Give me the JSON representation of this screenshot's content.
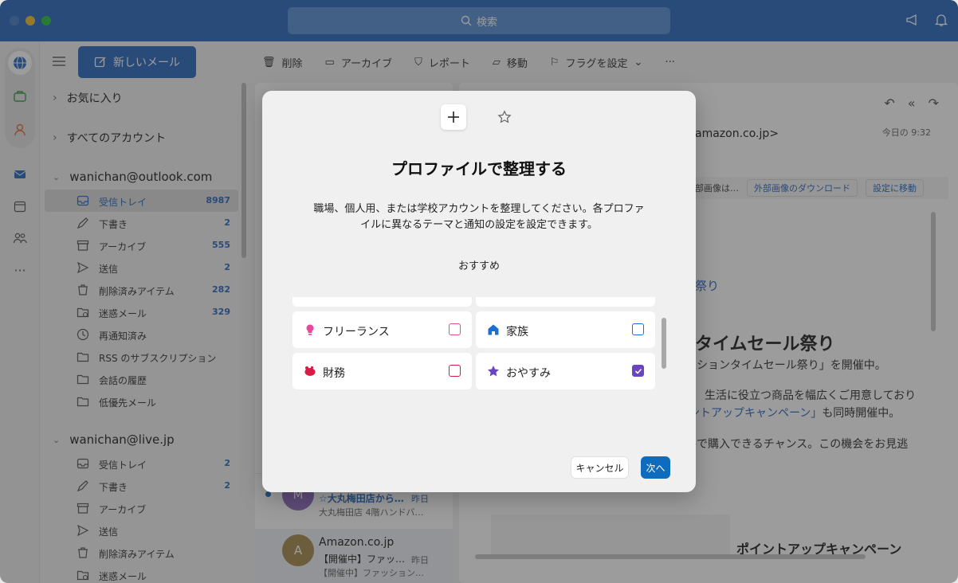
{
  "titlebar": {
    "search_label": "検索"
  },
  "toolbar": {
    "new_mail": "新しいメール",
    "actions": [
      "削除",
      "アーカイブ",
      "レポート",
      "移動",
      "フラグを設定"
    ]
  },
  "nav": {
    "favorites": "お気に入り",
    "all_accounts": "すべてのアカウント",
    "accounts": [
      {
        "name": "wanichan@outlook.com",
        "folders": [
          {
            "label": "受信トレイ",
            "count": "8987",
            "icon": "inbox-icon"
          },
          {
            "label": "下書き",
            "count": "2",
            "icon": "draft-icon"
          },
          {
            "label": "アーカイブ",
            "count": "555",
            "icon": "archive-icon"
          },
          {
            "label": "送信",
            "count": "2",
            "icon": "send-icon"
          },
          {
            "label": "削除済みアイテム",
            "count": "282",
            "icon": "trash-icon"
          },
          {
            "label": "迷惑メール",
            "count": "329",
            "icon": "junk-icon"
          },
          {
            "label": "再通知済み",
            "count": "",
            "icon": "clock-icon"
          },
          {
            "label": "RSS のサブスクリプション",
            "count": "",
            "icon": "folder-icon"
          },
          {
            "label": "会話の履歴",
            "count": "",
            "icon": "folder-icon"
          },
          {
            "label": "低優先メール",
            "count": "",
            "icon": "folder-icon"
          }
        ]
      },
      {
        "name": "wanichan@live.jp",
        "folders": [
          {
            "label": "受信トレイ",
            "count": "2",
            "icon": "inbox-icon"
          },
          {
            "label": "下書き",
            "count": "2",
            "icon": "draft-icon"
          },
          {
            "label": "アーカイブ",
            "count": "",
            "icon": "archive-icon"
          },
          {
            "label": "送信",
            "count": "",
            "icon": "send-icon"
          },
          {
            "label": "削除済みアイテム",
            "count": "",
            "icon": "trash-icon"
          },
          {
            "label": "迷惑メール",
            "count": "",
            "icon": "junk-icon"
          }
        ]
      }
    ]
  },
  "messages": [
    {
      "avatar": "M",
      "avatar_color": "#8e6bbf",
      "subject": "☆大丸梅田店から…",
      "date": "昨日",
      "preview": "大丸梅田店 4階ハンドバ…"
    },
    {
      "avatar": "A",
      "avatar_color": "#a68d4f",
      "sender": "Amazon.co.jp",
      "subject": "【開催中】ファッ…",
      "date": "昨日",
      "preview": "【開催中】ファッション…"
    }
  ],
  "reader": {
    "from_fragment": "amazon.co.jp>",
    "time": "今日の 9:32",
    "banner_fragment": "部画像は…",
    "download_btn": "外部画像のダウンロード",
    "settings_btn": "設定に移動",
    "link_fragment": "祭り",
    "heading_fragment": "タイムセール祭り",
    "line1": "ッションタイムセール祭り」を開催中。",
    "line2": "生活に役立つ商品を幅広くご用意しており",
    "line3a": "ントアップキャンペーン」",
    "line3b": "も同時開催中。",
    "line4": "格で購入できるチャンス。この機会をお見逃",
    "footer_heading": "ポイントアップキャンペーン"
  },
  "dialog": {
    "title": "プロファイルで整理する",
    "description": "職場、個人用、または学校アカウントを整理してください。各プロファイルに異なるテーマと通知の設定を設定できます。",
    "recommended": "おすすめ",
    "options": [
      {
        "label": "フリーランス",
        "color": "#e8479a",
        "checked": false,
        "icon": "lightbulb-icon"
      },
      {
        "label": "家族",
        "color": "#1c6fd0",
        "checked": false,
        "icon": "house-icon"
      },
      {
        "label": "財務",
        "color": "#d81b45",
        "checked": false,
        "icon": "piggy-bank-icon"
      },
      {
        "label": "おやすみ",
        "color": "#6b45c0",
        "checked": true,
        "icon": "star-icon"
      }
    ],
    "cancel": "キャンセル",
    "next": "次へ"
  },
  "colors": {
    "accent": "#2a6ac1",
    "primary_button": "#0f6cbd"
  }
}
